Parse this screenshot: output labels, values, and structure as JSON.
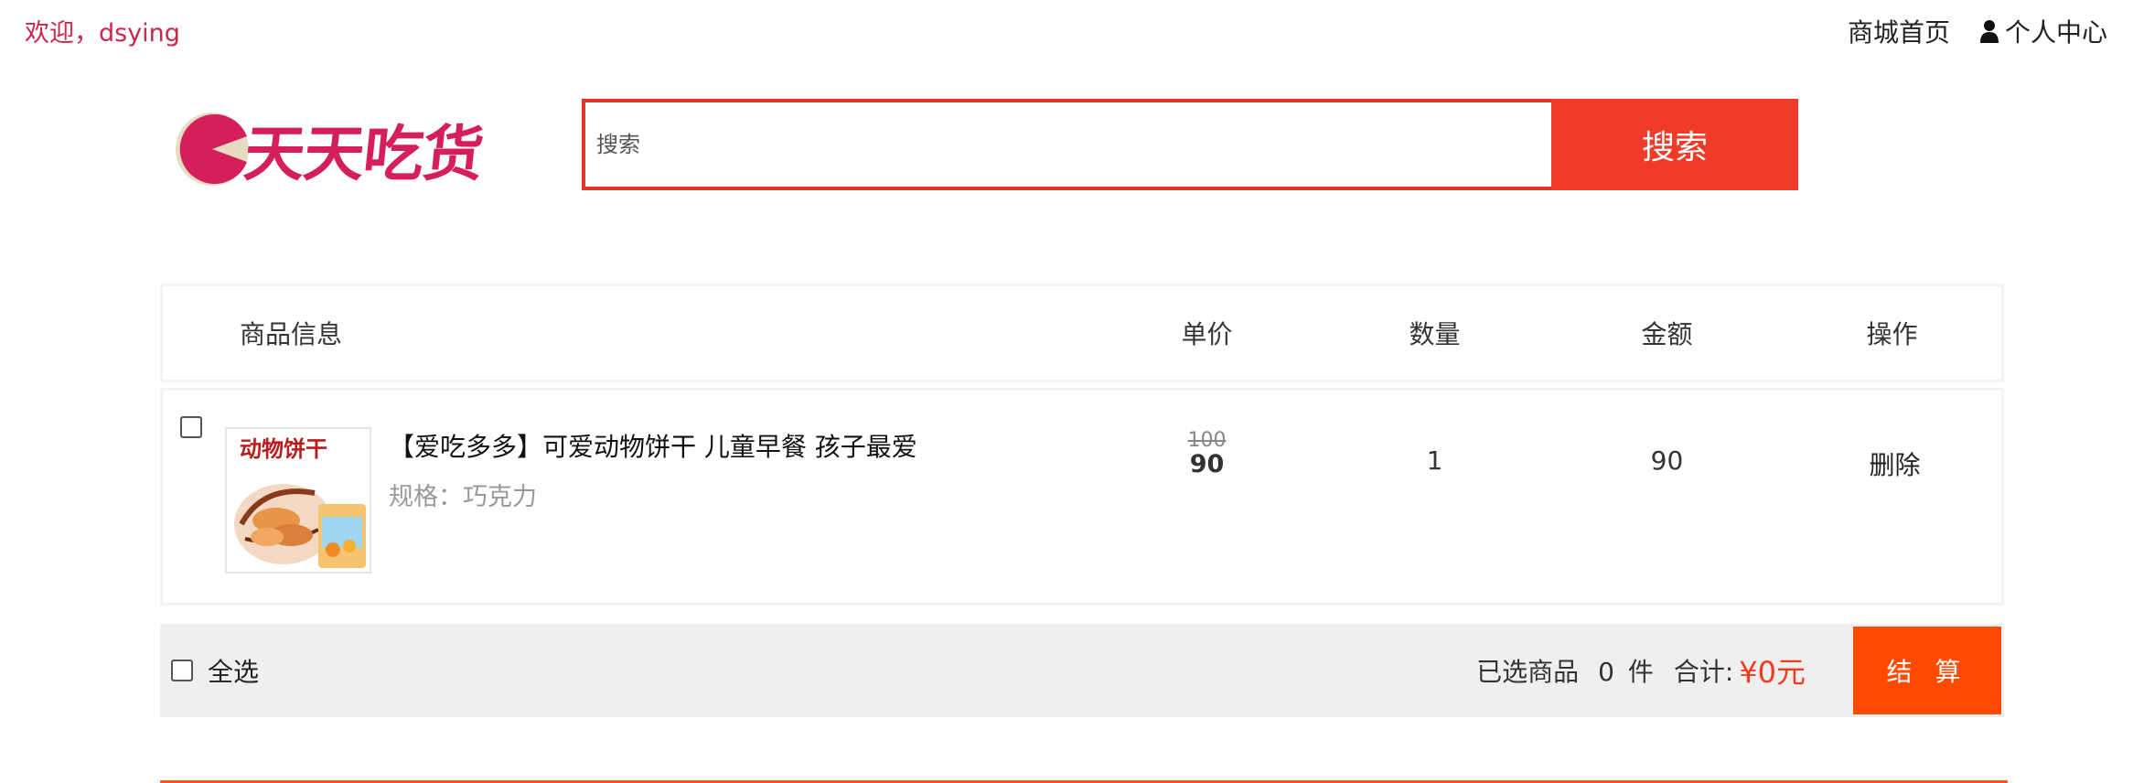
{
  "topbar": {
    "welcome": "欢迎，dsying",
    "home_link": "商城首页",
    "user_center": "个人中心",
    "user_icon": "user-icon"
  },
  "header": {
    "logo_text": "天天吃货",
    "search_placeholder": "搜索",
    "search_button": "搜索"
  },
  "cart": {
    "columns": [
      "商品信息",
      "单价",
      "数量",
      "金额",
      "操作"
    ],
    "items": [
      {
        "title": "【爱吃多多】可爱动物饼干 儿童早餐 孩子最爱",
        "spec": "规格：巧克力",
        "thumb_text": "动物饼干",
        "price_old": "100",
        "price_new": "90",
        "quantity": "1",
        "amount": "90",
        "action": "删除",
        "checked": false
      }
    ],
    "footer": {
      "select_all": "全选",
      "selected_label": "已选商品",
      "selected_count": "0",
      "selected_unit": "件",
      "total_label": "合计:",
      "total_value": "¥0元",
      "checkout": "结 算"
    }
  },
  "colors": {
    "accent": "#f03b29",
    "welcome": "#c8284a",
    "checkout": "#ff4a00",
    "total": "#f23c1e"
  }
}
